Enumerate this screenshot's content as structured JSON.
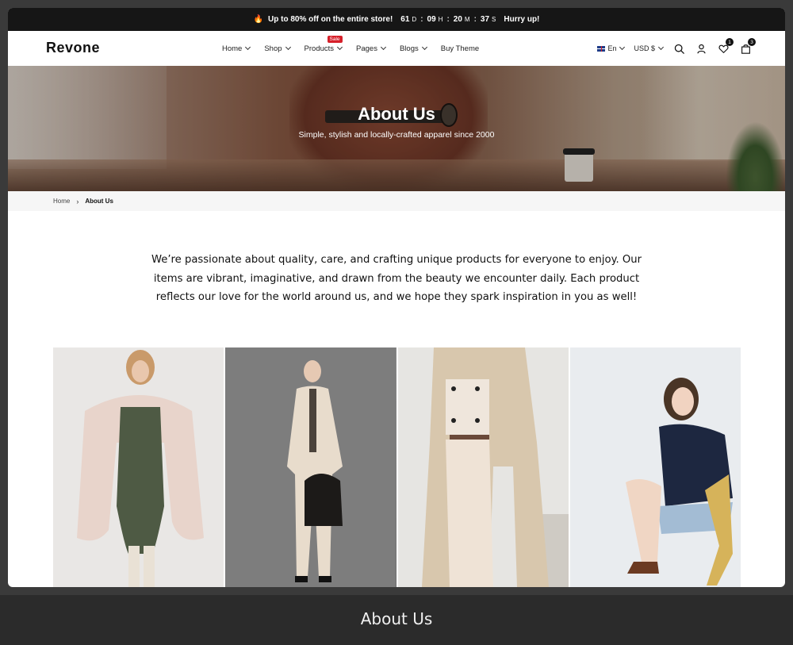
{
  "announcement": {
    "prefix_icon": "fire-icon",
    "text": "Up to 80% off on the entire store!",
    "countdown": [
      {
        "value": "61",
        "unit": "D"
      },
      {
        "value": "09",
        "unit": "H"
      },
      {
        "value": "20",
        "unit": "M"
      },
      {
        "value": "37",
        "unit": "S"
      }
    ],
    "cta": "Hurry up!"
  },
  "header": {
    "logo": "Revone",
    "nav": [
      {
        "label": "Home",
        "dropdown": true
      },
      {
        "label": "Shop",
        "dropdown": true
      },
      {
        "label": "Products",
        "dropdown": true,
        "badge": "Sale"
      },
      {
        "label": "Pages",
        "dropdown": true
      },
      {
        "label": "Blogs",
        "dropdown": true
      },
      {
        "label": "Buy Theme",
        "dropdown": false
      }
    ],
    "language": "En",
    "currency": "USD $",
    "wishlist_count": "1",
    "cart_count": "3"
  },
  "hero": {
    "title": "About Us",
    "subtitle": "Simple, stylish and locally-crafted apparel since 2000"
  },
  "breadcrumb": {
    "home": "Home",
    "current": "About Us"
  },
  "intro": {
    "text": "We’re passionate about quality, care, and crafting unique products for everyone to enjoy. Our items are vibrant, imaginative, and drawn from the beauty we encounter daily. Each product reflects our love for the world around us, and we hope they spark inspiration in you as well!"
  },
  "caption": "About Us",
  "colors": {
    "sale_badge": "#d6202a",
    "announcement_bg": "#161616",
    "page_bg": "#2b2b2b"
  }
}
